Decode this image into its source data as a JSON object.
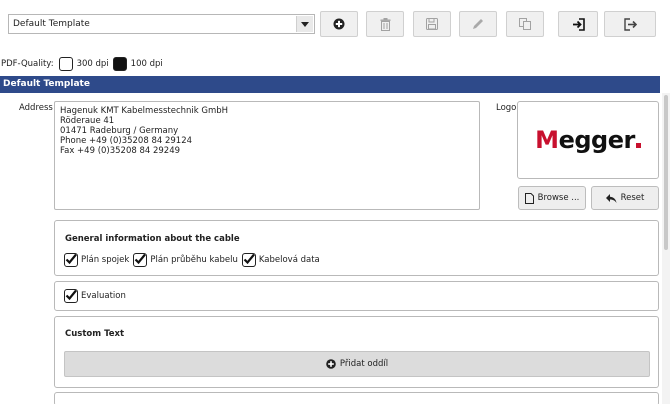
{
  "template_select": {
    "value": "Default Template"
  },
  "toolbar": {
    "buttons": [
      {
        "icon": "plus-circle-icon",
        "enabled": true
      },
      {
        "icon": "trash-icon",
        "enabled": false
      },
      {
        "icon": "floppy-icon",
        "enabled": false
      },
      {
        "icon": "pencil-icon",
        "enabled": false
      },
      {
        "icon": "copy-icon",
        "enabled": false
      },
      {
        "icon": "import-icon",
        "enabled": true
      },
      {
        "icon": "export-icon",
        "enabled": true
      }
    ]
  },
  "pdf_quality": {
    "label": "PDF-Quality:",
    "options": [
      {
        "label": "300 dpi",
        "selected": false
      },
      {
        "label": "100 dpi",
        "selected": true
      }
    ]
  },
  "section_title": "Default Template",
  "address": {
    "label": "Address",
    "lines": [
      "Hagenuk KMT Kabelmesstechnik GmbH",
      "Röderaue 41",
      "01471 Radeburg / Germany",
      "Phone +49 (0)35208 84 29124",
      "Fax +49 (0)35208 84 29249"
    ]
  },
  "logo": {
    "label": "Logo",
    "brand_text_m": "M",
    "brand_text_rest": "egger",
    "brand_color": "#c8102e",
    "browse_label": "Browse ...",
    "reset_label": "Reset"
  },
  "general_panel": {
    "title": "General information about the cable",
    "items": [
      {
        "label": "Plán spojek",
        "checked": true
      },
      {
        "label": "Plán průběhu kabelu",
        "checked": true
      },
      {
        "label": "Kabelová data",
        "checked": true
      }
    ]
  },
  "evaluation_panel": {
    "label": "Evaluation",
    "checked": true
  },
  "custom_text_panel": {
    "title": "Custom Text",
    "add_label": "Přidat oddíl"
  },
  "colors": {
    "header_bar": "#2e4a8a",
    "accent": "#c8102e"
  }
}
